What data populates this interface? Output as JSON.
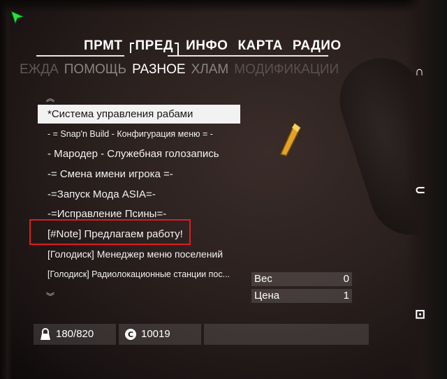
{
  "top_tabs": [
    "ПРМТ",
    "ПРЕД",
    "ИНФО",
    "КАРТА",
    "РАДИО"
  ],
  "sub_tabs": {
    "clipped": "ЕЖДА",
    "help": "ПОМОЩЬ",
    "active": "РАЗНОЕ",
    "junk": "ХЛАМ",
    "mods": "МОДИФИКАЦИИ"
  },
  "items": [
    "*Система управления рабами",
    "- = Snap'n Build - Конфигурация меню  = -",
    "- Мародер - Служебная голозапись",
    "-= Смена имени игрока =-",
    "-=Запуск Мода ASIA=-",
    "-=Исправление Псины=-",
    "[#Note] Предлагаем работу!",
    "[Голодиск] Менеджер меню поселений",
    "[Голодиск] Радиолокационные станции пос..."
  ],
  "stats": {
    "weight_label": "Вес",
    "weight_value": "0",
    "value_label": "Цена",
    "value_value": "1"
  },
  "bottom": {
    "carry": "180/820",
    "caps": "10019"
  },
  "colors": {
    "text": "#ffffff",
    "dim": "#8a8483",
    "highlight": "#e01b24",
    "cursor": "#27e33b"
  }
}
